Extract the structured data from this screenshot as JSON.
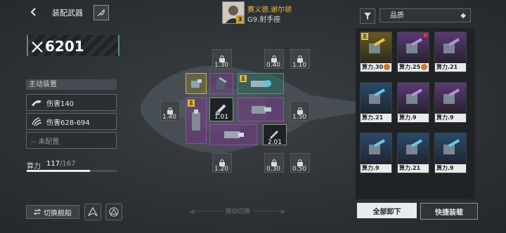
{
  "header": {
    "title": "装配武器"
  },
  "pilot": {
    "name": "赛义德.谢尔顿",
    "subtitle": "G9.射手座",
    "level": "3"
  },
  "power": {
    "value": "6201"
  },
  "active_gear": {
    "header": "主动装置",
    "items": [
      {
        "label": "伤害140",
        "icon": "sweep-icon"
      },
      {
        "label": "伤害628-694",
        "icon": "claw-icon"
      },
      {
        "label": "-- 未配置",
        "icon": "none"
      }
    ]
  },
  "compute": {
    "label": "算力",
    "used": "117",
    "total": "/167",
    "fraction": 0.7
  },
  "buttons": {
    "switch_ship": "切换舰船",
    "swipe_hint": "滑动切换",
    "unequip_all": "全部卸下",
    "quick_equip": "快捷装载"
  },
  "sort": {
    "label": "品质"
  },
  "slots": {
    "locked": [
      "1.30",
      "0.40",
      "1.10",
      "1.40",
      "1.50",
      "1.20",
      "0.30",
      "0.50"
    ],
    "filled": [
      "1.01",
      "2.01"
    ],
    "main_tag": "主"
  },
  "inventory": [
    {
      "caption": "算力.30",
      "tier": "gold",
      "main": true,
      "badge": true,
      "red": false
    },
    {
      "caption": "算力.25",
      "tier": "purple",
      "main": false,
      "badge": true,
      "red": true
    },
    {
      "caption": "算力.21",
      "tier": "purple",
      "main": false,
      "badge": false,
      "red": false
    },
    {
      "caption": "算力.21",
      "tier": "blue",
      "main": false,
      "badge": false,
      "red": false
    },
    {
      "caption": "算力.9",
      "tier": "purple",
      "main": false,
      "badge": false,
      "red": false
    },
    {
      "caption": "算力.9",
      "tier": "purple",
      "main": false,
      "badge": false,
      "red": false
    },
    {
      "caption": "算力.9",
      "tier": "blue",
      "main": false,
      "badge": false,
      "red": false
    },
    {
      "caption": "算力.21",
      "tier": "blue",
      "main": false,
      "badge": false,
      "red": false
    },
    {
      "caption": "算力.9",
      "tier": "blue",
      "main": false,
      "badge": false,
      "red": false
    }
  ]
}
